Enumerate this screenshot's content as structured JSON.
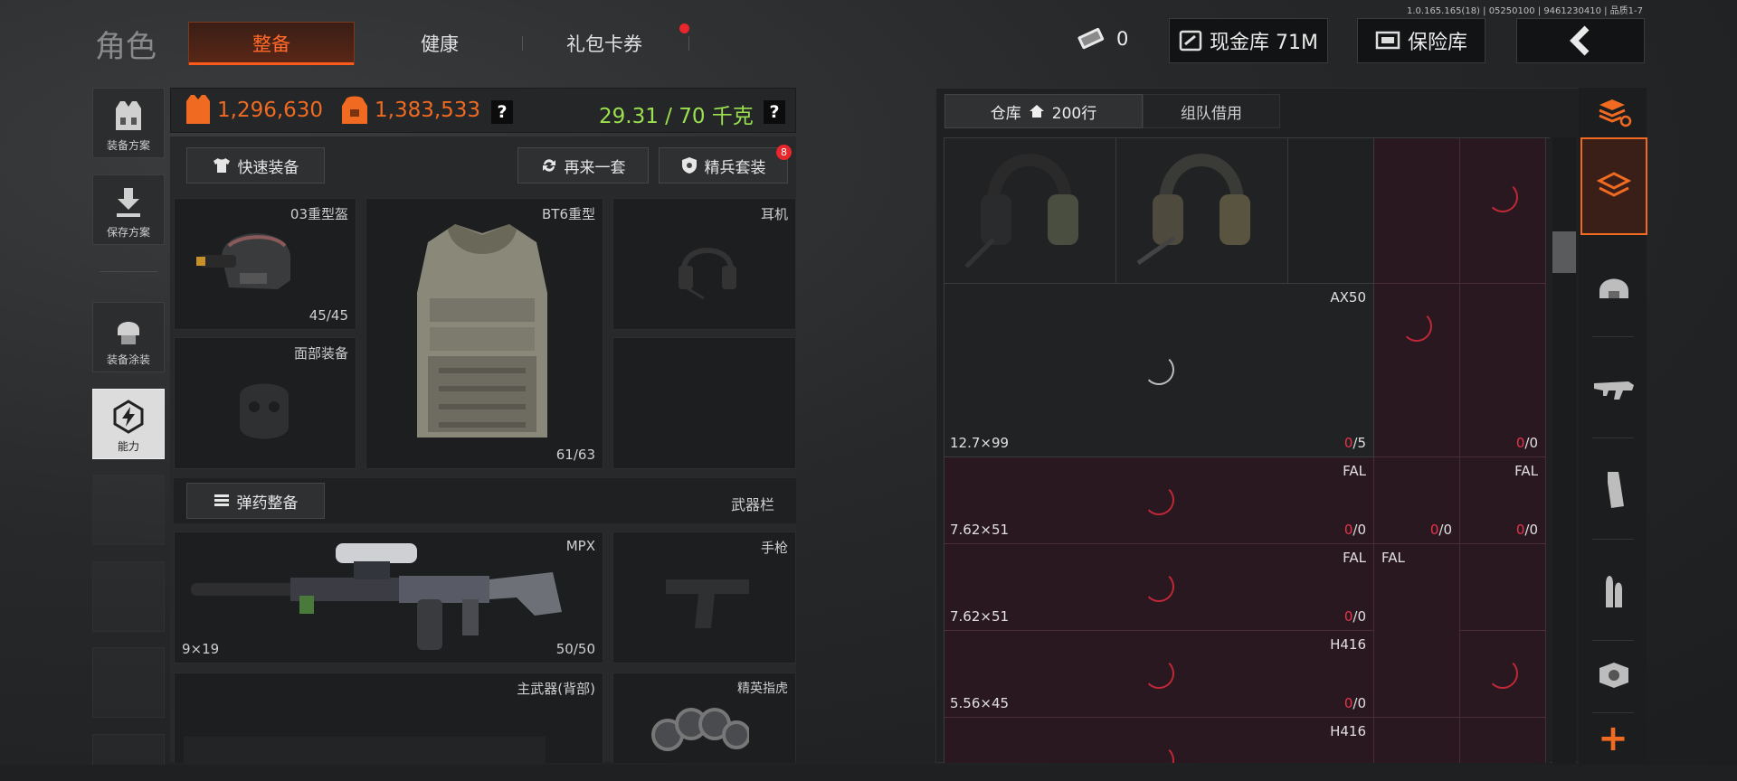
{
  "version": "1.0.165.165(18) | 05250100 | 9461230410 | 品质1-7",
  "header": {
    "title": "角色",
    "tabs": [
      {
        "label": "整备"
      },
      {
        "label": "健康"
      },
      {
        "label": "礼包卡券"
      }
    ],
    "coins": "0",
    "cash_label": "现金库 71M",
    "safe_label": "保险库"
  },
  "sidebar": [
    {
      "label": "装备方案"
    },
    {
      "label": "保存方案"
    },
    {
      "label": "装备涂装"
    },
    {
      "label": "能力"
    }
  ],
  "stats": {
    "value1": "1,296,630",
    "value2": "1,383,533",
    "q": "?",
    "weight": "29.31 / 70 千克",
    "q2": "?"
  },
  "actions": {
    "quick": "快速装备",
    "again": "再来一套",
    "elite": "精兵套装",
    "elite_badge": "8",
    "ammo": "弹药整备"
  },
  "slots": {
    "helmet": {
      "name": "03重型盔",
      "durability": "45/45"
    },
    "armor": {
      "name": "BT6重型",
      "durability": "61/63"
    },
    "headset": {
      "name": "耳机"
    },
    "face": {
      "name": "面部装备"
    },
    "weapons_title": "武器栏",
    "primary": {
      "name": "MPX",
      "caliber": "9×19",
      "ammo": "50/50"
    },
    "pistol": {
      "name": "手枪"
    },
    "back": {
      "name": "主武器(背部)"
    },
    "melee": {
      "name": "精英指虎"
    }
  },
  "storage": {
    "tab_warehouse": "仓库",
    "rows": "200行",
    "tab_team": "组队借用",
    "items": [
      {
        "name": "AX50",
        "caliber": "12.7×99",
        "left": "0",
        "right": "/5"
      },
      {
        "name": "FAL",
        "caliber": "7.62×51",
        "left": "0",
        "right": "/0"
      },
      {
        "name": "FAL",
        "caliber": "7.62×51",
        "left": "0",
        "right": "/0"
      },
      {
        "name": "H416",
        "caliber": "5.56×45",
        "left": "0",
        "right": "/0"
      },
      {
        "name": "H416"
      }
    ],
    "extra": [
      {
        "name": "FAL",
        "left": "0",
        "right": "/0"
      },
      {
        "name": "FAL"
      },
      {
        "left": "0",
        "right": "/0"
      },
      {
        "left": "0",
        "right": "/0"
      }
    ],
    "plus": "+"
  }
}
